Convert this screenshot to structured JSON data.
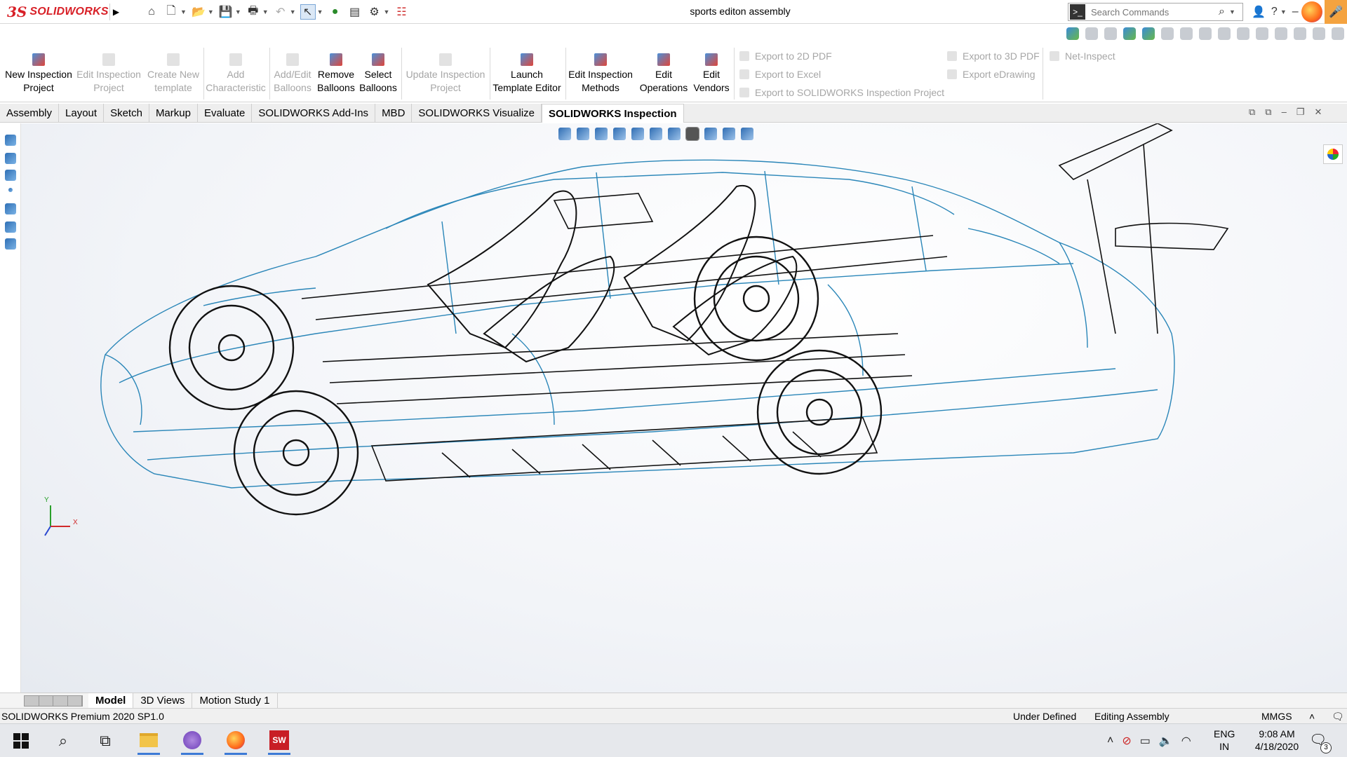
{
  "app": {
    "logo_ds": "3S",
    "logo_text": "SOLIDWORKS",
    "document_title": "sports editon assembly"
  },
  "search": {
    "placeholder": "Search Commands"
  },
  "ribbon": {
    "new_inspection_project": "New Inspection Project",
    "edit_inspection_project": "Edit Inspection Project",
    "create_new_template": "Create New template",
    "add_characteristic": "Add Characteristic",
    "add_edit_balloons": "Add/Edit Balloons",
    "remove_balloons": "Remove Balloons",
    "select_balloons": "Select Balloons",
    "update_inspection_project": "Update Inspection Project",
    "launch_template_editor": "Launch Template Editor",
    "edit_inspection_methods": "Edit Inspection Methods",
    "edit_operations": "Edit Operations",
    "edit_vendors": "Edit Vendors",
    "export_2d_pdf": "Export to 2D PDF",
    "export_excel": "Export to Excel",
    "export_sw_inspection": "Export to SOLIDWORKS Inspection Project",
    "export_3d_pdf": "Export to 3D PDF",
    "export_edrawing": "Export eDrawing",
    "net_inspect": "Net-Inspect"
  },
  "tabs": [
    "Assembly",
    "Layout",
    "Sketch",
    "Markup",
    "Evaluate",
    "SOLIDWORKS Add-Ins",
    "MBD",
    "SOLIDWORKS Visualize",
    "SOLIDWORKS Inspection"
  ],
  "active_tab": "SOLIDWORKS Inspection",
  "triad": {
    "y": "Y",
    "x": "X"
  },
  "bottom_tabs": [
    "Model",
    "3D Views",
    "Motion Study 1"
  ],
  "status": {
    "product": "SOLIDWORKS Premium 2020 SP1.0",
    "definition": "Under Defined",
    "mode": "Editing Assembly",
    "units": "MMGS"
  },
  "taskbar": {
    "lang_line1": "ENG",
    "lang_line2": "IN",
    "time": "9:08 AM",
    "date": "4/18/2020",
    "notifications": "3",
    "sw_label": "SW"
  },
  "colors": {
    "brand_red": "#d82027",
    "wire_blue": "#2a86b8",
    "wire_black": "#111111"
  }
}
